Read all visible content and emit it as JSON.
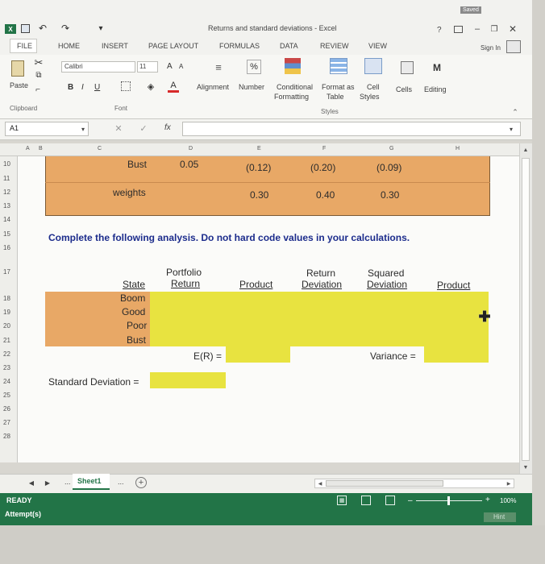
{
  "window": {
    "title": "Returns and standard deviations - Excel",
    "save_status": "Saved",
    "help": "?",
    "sign_in": "Sign In"
  },
  "ribbon": {
    "tabs": [
      "FILE",
      "HOME",
      "INSERT",
      "PAGE LAYOUT",
      "FORMULAS",
      "DATA",
      "REVIEW",
      "VIEW"
    ],
    "font_name": "Calibri",
    "font_size": "11",
    "paste_label": "Paste",
    "alignment_label": "Alignment",
    "number_label": "Number",
    "conditional_formatting": [
      "Conditional",
      "Formatting"
    ],
    "format_as_table": [
      "Format as",
      "Table"
    ],
    "cell_styles": [
      "Cell",
      "Styles"
    ],
    "cells_label": "Cells",
    "editing_label": "Editing",
    "groups": [
      "Clipboard",
      "Font",
      "Styles"
    ],
    "bold": "B",
    "italic": "I",
    "underline": "U",
    "grow_font": "A",
    "shrink_font": "A",
    "percent": "%"
  },
  "formula_bar": {
    "name_box": "A1",
    "fx": "fx",
    "value": ""
  },
  "columns": [
    "A",
    "B",
    "C",
    "D",
    "E",
    "F",
    "G",
    "H"
  ],
  "rows": [
    "10",
    "11",
    "12",
    "13",
    "14",
    "15",
    "16",
    "17",
    "18",
    "19",
    "20",
    "21",
    "22",
    "23",
    "24",
    "25",
    "26",
    "27",
    "28"
  ],
  "top_table": {
    "bust_label": "Bust",
    "bust_values": [
      "0.05",
      "(0.12)",
      "(0.20)",
      "(0.09)"
    ],
    "weights_label": "weights",
    "weights_values": [
      "0.30",
      "0.40",
      "0.30"
    ]
  },
  "instruction": "Complete the following analysis. Do not hard code values in your calculations.",
  "analysis": {
    "headers": {
      "state": "State",
      "portfolio": [
        "Portfolio",
        "Return"
      ],
      "product": "Product",
      "return_dev": [
        "Return",
        "Deviation"
      ],
      "squared_dev": [
        "Squared",
        "Deviation"
      ],
      "product2": "Product"
    },
    "states": [
      "Boom",
      "Good",
      "Poor",
      "Bust"
    ],
    "er_label": "E(R) =",
    "variance_label": "Variance =",
    "stddev_label": "Standard Deviation ="
  },
  "sheet_tabs": {
    "active": "Sheet1",
    "ellipsis_left": "...",
    "ellipsis_right": "..."
  },
  "status": {
    "ready": "READY",
    "zoom": "100%",
    "attempts": "Attempt(s)",
    "hint": "Hint"
  },
  "colors": {
    "orange_fill": "#e8a866",
    "yellow_fill": "#e8e340",
    "excel_green": "#227447",
    "instruction_text": "#1c2c8c"
  }
}
